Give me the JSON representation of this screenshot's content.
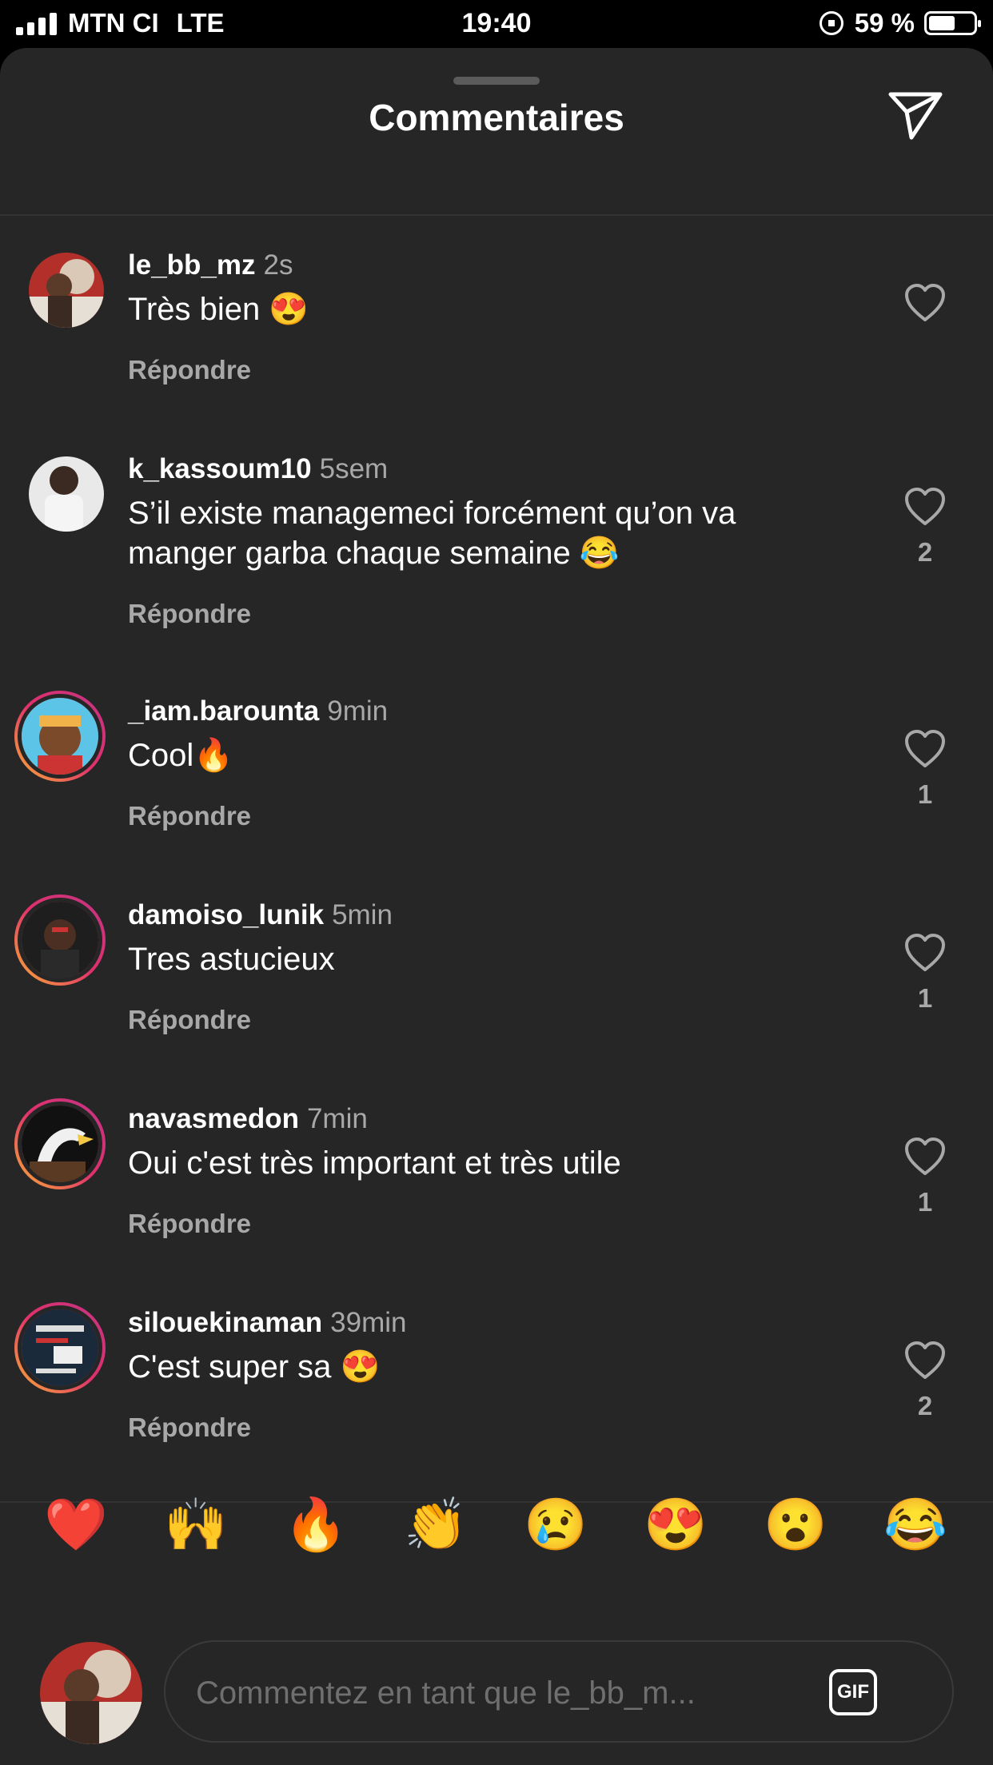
{
  "status": {
    "carrier": "MTN CI",
    "network": "LTE",
    "time": "19:40",
    "battery_text": "59 %",
    "battery_level": 0.59
  },
  "header": {
    "title": "Commentaires",
    "share_icon": "paper-plane-icon"
  },
  "reply_label": "Répondre",
  "comments": [
    {
      "user": "le_bb_mz",
      "time": "2s",
      "text": "Très bien 😍",
      "likes": ""
    },
    {
      "user": "k_kassoum10",
      "time": "5sem",
      "text": "S’il existe managemeci forcément qu’on va manger garba chaque semaine 😂",
      "likes": "2"
    },
    {
      "user": "_iam.barounta",
      "time": "9min",
      "text": "Cool🔥",
      "likes": "1"
    },
    {
      "user": "damoiso_lunik",
      "time": "5min",
      "text": "Tres astucieux",
      "likes": "1"
    },
    {
      "user": "navasmedon",
      "time": "7min",
      "text": "Oui c'est très important et très utile",
      "likes": "1"
    },
    {
      "user": "silouekinaman",
      "time": "39min",
      "text": "C'est super sa 😍",
      "likes": "2"
    }
  ],
  "emoji_bar": [
    "❤️",
    "🙌",
    "🔥",
    "👏",
    "😢",
    "😍",
    "😮",
    "😂"
  ],
  "input": {
    "placeholder": "Commentez en tant que le_bb_m...",
    "gif_label": "GIF"
  }
}
